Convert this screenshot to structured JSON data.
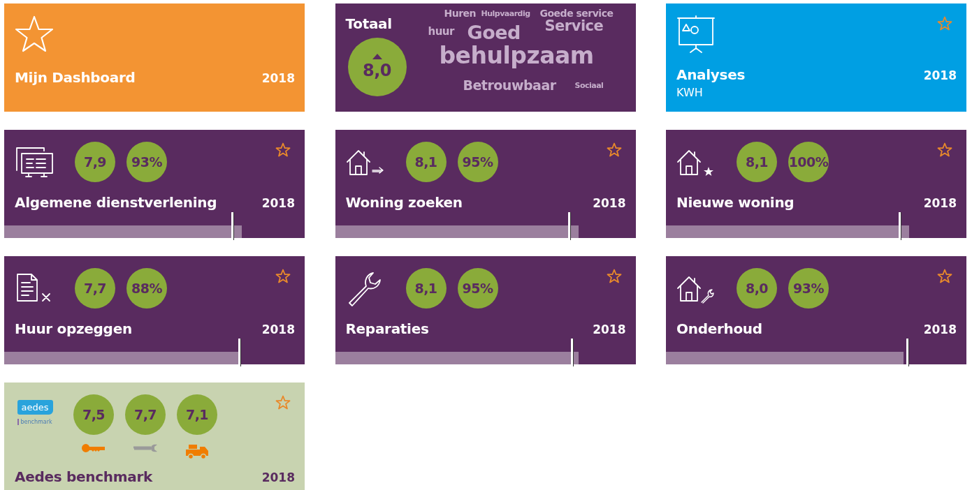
{
  "tiles": [
    {
      "kind": "dashboard",
      "title": "Mijn Dashboard",
      "year": "2018"
    },
    {
      "kind": "total",
      "title": "Totaal",
      "score": "8,0",
      "words": [
        "Huren",
        "Hulpvaardig",
        "Goede service",
        "huur",
        "Goed",
        "Service",
        "behulpzaam",
        "Betrouwbaar",
        "Sociaal"
      ]
    },
    {
      "kind": "analysis",
      "title": "Analyses",
      "subtitle": "KWH",
      "year": "2018"
    },
    {
      "kind": "survey",
      "title": "Algemene dienstverlening",
      "year": "2018",
      "scores": [
        "7,9",
        "93%"
      ],
      "progress": {
        "level": 0.79
      },
      "benchmark": {
        "level": 0.756
      }
    },
    {
      "kind": "survey",
      "title": "Woning zoeken",
      "year": "2018",
      "scores": [
        "8,1",
        "95%"
      ],
      "progress": {
        "level": 0.81
      },
      "benchmark": {
        "level": 0.775
      }
    },
    {
      "kind": "survey",
      "title": "Nieuwe woning",
      "year": "2018",
      "scores": [
        "8,1",
        "100%"
      ],
      "progress": {
        "level": 0.81
      },
      "benchmark": {
        "level": 0.775
      }
    },
    {
      "kind": "survey",
      "title": "Huur opzeggen",
      "year": "2018",
      "scores": [
        "7,7",
        "88%"
      ],
      "progress": {
        "level": 0.78
      },
      "benchmark": {
        "level": 0.78
      }
    },
    {
      "kind": "survey",
      "title": "Reparaties",
      "year": "2018",
      "scores": [
        "8,1",
        "95%"
      ],
      "progress": {
        "level": 0.81
      },
      "benchmark": {
        "level": 0.785
      }
    },
    {
      "kind": "survey",
      "title": "Onderhoud",
      "year": "2018",
      "scores": [
        "8,0",
        "93%"
      ],
      "progress": {
        "level": 0.79
      },
      "benchmark": {
        "level": 0.8
      }
    },
    {
      "kind": "benchmark",
      "logo": [
        "aedes",
        "benchmark"
      ],
      "title": "Aedes benchmark",
      "year": "2018",
      "scores": [
        "7,5",
        "7,7",
        "7,1"
      ]
    }
  ]
}
